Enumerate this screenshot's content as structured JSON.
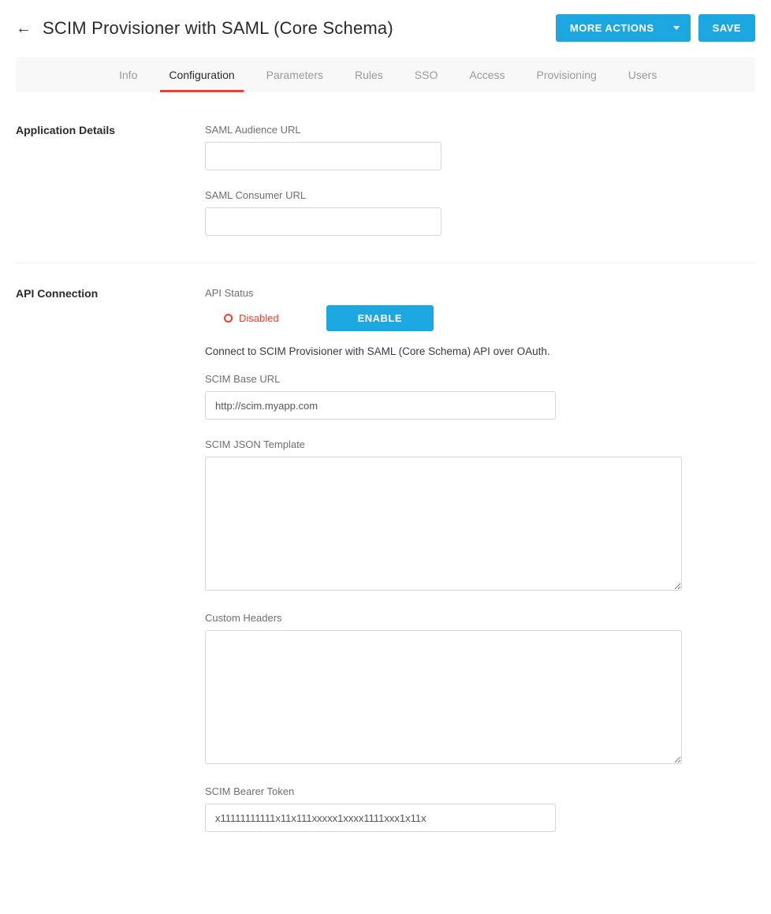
{
  "header": {
    "title": "SCIM Provisioner with SAML (Core Schema)",
    "more_actions_label": "MORE ACTIONS",
    "save_label": "SAVE"
  },
  "tabs": [
    {
      "label": "Info",
      "active": false
    },
    {
      "label": "Configuration",
      "active": true
    },
    {
      "label": "Parameters",
      "active": false
    },
    {
      "label": "Rules",
      "active": false
    },
    {
      "label": "SSO",
      "active": false
    },
    {
      "label": "Access",
      "active": false
    },
    {
      "label": "Provisioning",
      "active": false
    },
    {
      "label": "Users",
      "active": false
    }
  ],
  "sections": {
    "app_details": {
      "title": "Application Details",
      "saml_audience_label": "SAML Audience URL",
      "saml_audience_value": "",
      "saml_consumer_label": "SAML Consumer URL",
      "saml_consumer_value": ""
    },
    "api_connection": {
      "title": "API Connection",
      "api_status_label": "API Status",
      "status_text": "Disabled",
      "enable_button_label": "ENABLE",
      "help_text": "Connect to SCIM Provisioner with SAML (Core Schema) API over OAuth.",
      "scim_base_url_label": "SCIM Base URL",
      "scim_base_url_value": "http://scim.myapp.com",
      "scim_json_template_label": "SCIM JSON Template",
      "scim_json_template_value": "",
      "custom_headers_label": "Custom Headers",
      "custom_headers_value": "",
      "scim_bearer_token_label": "SCIM Bearer Token",
      "scim_bearer_token_value": "x11111111111x11x111xxxxx1xxxx1111xxx1x11x"
    }
  }
}
